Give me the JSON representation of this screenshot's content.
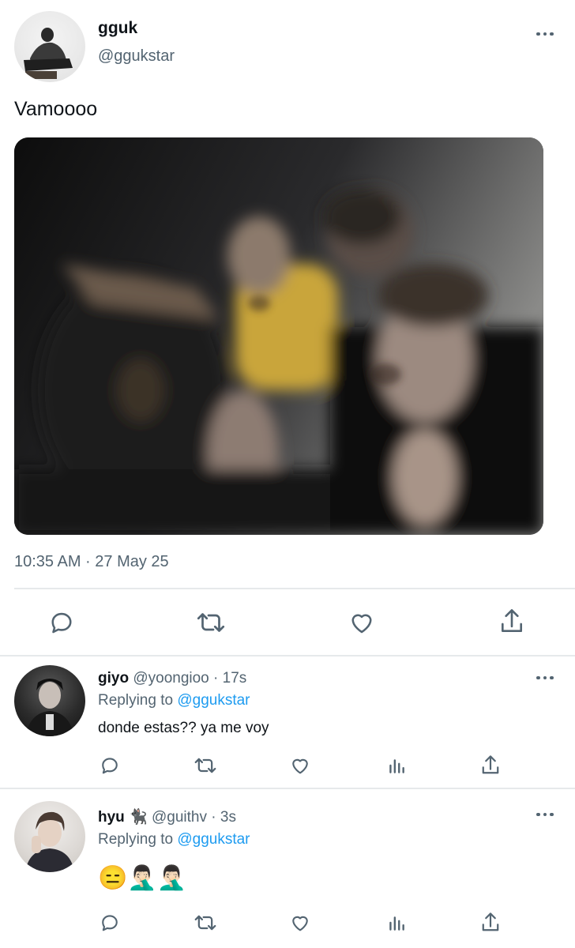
{
  "tweet": {
    "name": "gguk",
    "handle": "@ggukstar",
    "text": "Vamoooo",
    "timestamp": "10:35 AM · 27 May 25",
    "actions": [
      "reply-icon",
      "retweet-icon",
      "like-icon",
      "share-icon"
    ]
  },
  "replies": [
    {
      "name": "giyo",
      "handle": "@yoongioo · 17s",
      "replying_prefix": "Replying to",
      "replying_to": "@ggukstar",
      "text": "donde estas?? ya me voy"
    },
    {
      "name": "hyu",
      "name_emoji": "🐈‍⬛",
      "handle": "@guithv · 3s",
      "replying_prefix": "Replying to",
      "replying_to": "@ggukstar",
      "text": "😑🤦🏻‍♂️🤦🏻‍♂️"
    }
  ],
  "colors": {
    "accent": "#1d9bf0",
    "muted": "#536471",
    "divider": "#e6e9eb"
  }
}
